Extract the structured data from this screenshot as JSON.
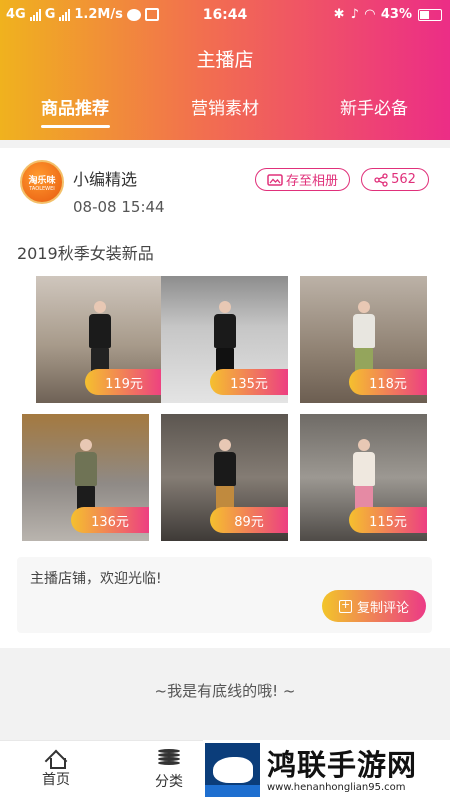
{
  "status_bar": {
    "network1": "4G",
    "network2": "G",
    "speed": "1.2M/s",
    "time": "16:44",
    "battery": "43%"
  },
  "header": {
    "title": "主播店",
    "tabs": [
      {
        "label": "商品推荐",
        "active": true
      },
      {
        "label": "营销素材",
        "active": false
      },
      {
        "label": "新手必备",
        "active": false
      }
    ]
  },
  "post": {
    "avatar_text": "淘乐味",
    "avatar_subtext": "TAOLEWEI",
    "author": "小编精选",
    "time": "08-08 15:44",
    "save_label": "存至相册",
    "share_count": "562",
    "title": "2019秋季女装新品",
    "products": [
      {
        "price": "119元"
      },
      {
        "price": "135元"
      },
      {
        "price": "118元"
      },
      {
        "price": "136元"
      },
      {
        "price": "89元"
      },
      {
        "price": "115元"
      }
    ],
    "comment": "主播店铺，欢迎光临!",
    "copy_label": "复制评论"
  },
  "footer_text": "~我是有底线的哦! ~",
  "bottom_nav": [
    {
      "label": "首页",
      "icon": "home-icon"
    },
    {
      "label": "分类",
      "icon": "category-icon"
    }
  ],
  "watermark": {
    "title": "鸿联手游网",
    "url": "www.henanhonglian95.com"
  },
  "colors": {
    "gradient_start": "#f0b21e",
    "gradient_end": "#ec2d86",
    "accent": "#e0307a"
  }
}
